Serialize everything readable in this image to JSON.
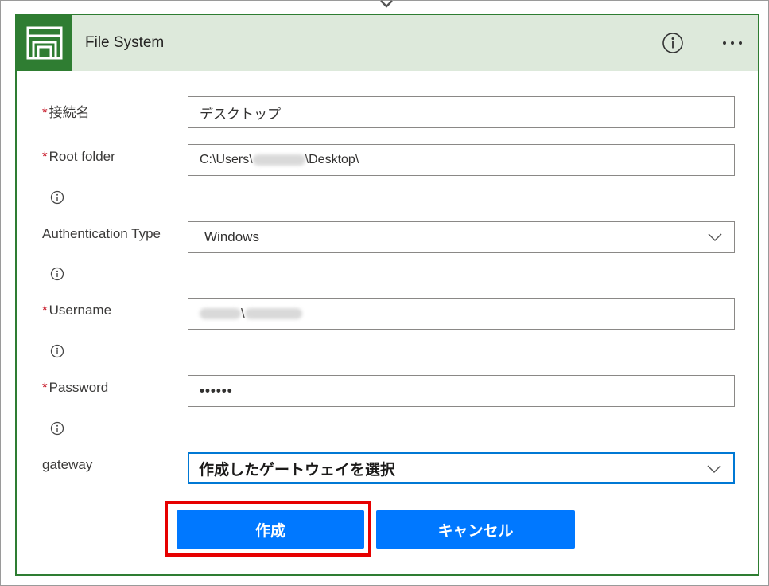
{
  "card": {
    "title": "File System",
    "icon": "file-system-icon",
    "header_bg": "#dde9db",
    "accent": "#2e7d32"
  },
  "fields": {
    "connection_name": {
      "label": "接続名",
      "required": true,
      "value": "デスクトップ"
    },
    "root_folder": {
      "label": "Root folder",
      "required": true,
      "value_prefix": "C:\\Users\\",
      "value_suffix": "\\Desktop\\"
    },
    "auth_type": {
      "label": "Authentication Type",
      "required": false,
      "value": "Windows"
    },
    "username": {
      "label": "Username",
      "required": true,
      "separator": "\\"
    },
    "password": {
      "label": "Password",
      "required": true,
      "value": "••••••"
    },
    "gateway": {
      "label": "gateway",
      "required": false,
      "value": "作成したゲートウェイを選択"
    }
  },
  "buttons": {
    "create": "作成",
    "cancel": "キャンセル",
    "primary_color": "#0078ff"
  },
  "highlight_color": "#e60000"
}
